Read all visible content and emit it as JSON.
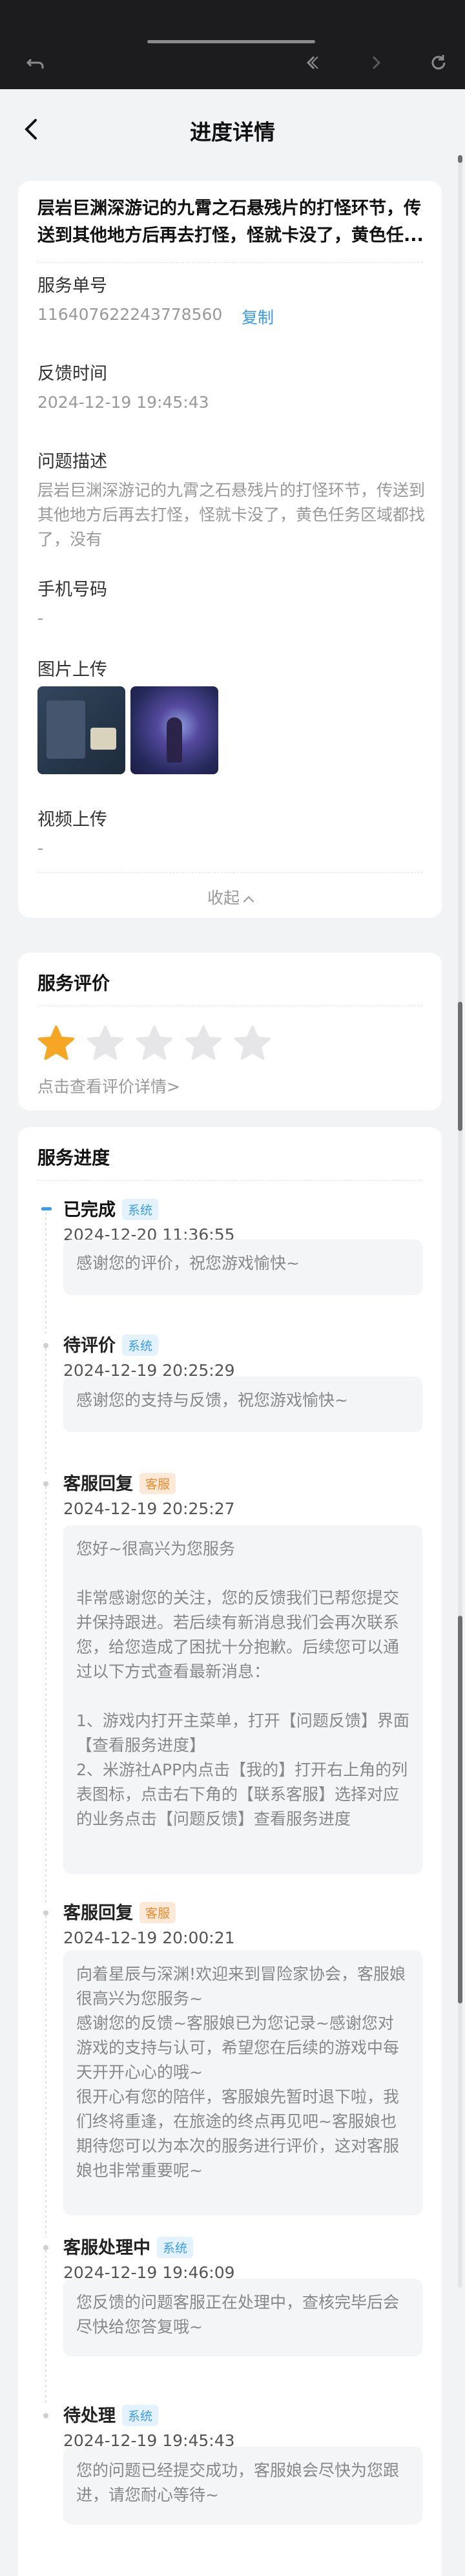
{
  "browser": {
    "icons": [
      "undo-icon",
      "prev-icon",
      "next-icon",
      "refresh-icon"
    ]
  },
  "header": {
    "title": "进度详情"
  },
  "feedback": {
    "issue_title": "层岩巨渊深游记的九霄之石悬残片的打怪环节，传送到其他地方后再去打怪，怪就卡没了，黄色任...",
    "service_no_label": "服务单号",
    "service_no": "116407622243778560",
    "copy_label": "复制",
    "time_label": "反馈时间",
    "time": "2024-12-19 19:45:43",
    "desc_label": "问题描述",
    "desc": "层岩巨渊深游记的九霄之石悬残片的打怪环节，传送到其他地方后再去打怪，怪就卡没了，黄色任务区域都找了，没有",
    "phone_label": "手机号码",
    "phone": "-",
    "image_label": "图片上传",
    "video_label": "视频上传",
    "video": "-",
    "collapse_label": "收起"
  },
  "rating": {
    "title": "服务评价",
    "stars": 1,
    "max_stars": 5,
    "link": "点击查看评价详情>"
  },
  "progress": {
    "title": "服务进度",
    "badges": {
      "system": "系统",
      "service": "客服"
    },
    "steps": [
      {
        "status": "已完成",
        "badge": "系统",
        "time": "2024-12-20 11:36:55",
        "message": "感谢您的评价，祝您游戏愉快~"
      },
      {
        "status": "待评价",
        "badge": "系统",
        "time": "2024-12-19 20:25:29",
        "message": "感谢您的支持与反馈，祝您游戏愉快~"
      },
      {
        "status": "客服回复",
        "badge": "客服",
        "time": "2024-12-19 20:25:27",
        "message": "您好~很高兴为您服务\n\n非常感谢您的关注，您的反馈我们已帮您提交并保持跟进。若后续有新消息我们会再次联系您，给您造成了困扰十分抱歉。后续您可以通过以下方式查看最新消息：\n\n1、游戏内打开主菜单，打开【问题反馈】界面【查看服务进度】\n2、米游社APP内点击【我的】打开右上角的列表图标，点击右下角的【联系客服】选择对应的业务点击【问题反馈】查看服务进度"
      },
      {
        "status": "客服回复",
        "badge": "客服",
        "time": "2024-12-19 20:00:21",
        "message": "向着星辰与深渊!欢迎来到冒险家协会，客服娘很高兴为您服务~\n感谢您的反馈~客服娘已为您记录~感谢您对游戏的支持与认可，希望您在后续的游戏中每天开开心心的哦~\n很开心有您的陪伴，客服娘先暂时退下啦，我们终将重逢，在旅途的终点再见吧~客服娘也期待您可以为本次的服务进行评价，这对客服娘也非常重要呢~"
      },
      {
        "status": "客服处理中",
        "badge": "系统",
        "time": "2024-12-19 19:46:09",
        "message": "您反馈的问题客服正在处理中，查核完毕后会尽快给您答复哦~"
      },
      {
        "status": "待处理",
        "badge": "系统",
        "time": "2024-12-19 19:45:43",
        "message": "您的问题已经提交成功，客服娘会尽快为您跟进，请您耐心等待~"
      }
    ]
  },
  "colors": {
    "accent": "#3a9cf0",
    "star": "#f5a623",
    "service_badge": "#f08a2c"
  }
}
